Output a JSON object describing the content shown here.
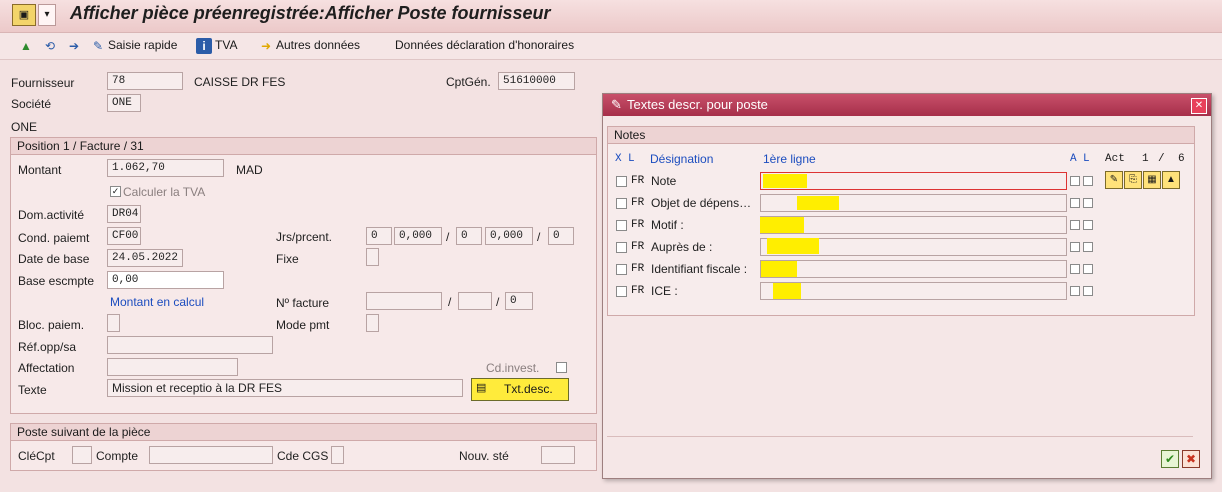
{
  "window": {
    "title": "Afficher pièce préenregistrée:Afficher Poste fournisseur"
  },
  "toolbar": {
    "saisie_rapide": "Saisie rapide",
    "tva": "TVA",
    "autres_donnees": "Autres données",
    "declaration": "Données déclaration d'honoraires"
  },
  "header": {
    "fournisseur_label": "Fournisseur",
    "fournisseur_value": "78",
    "fournisseur_name": "CAISSE DR FES",
    "cptgen_label": "CptGén.",
    "cptgen_value": "51610000",
    "societe_label": "Société",
    "societe_value": "ONE",
    "societe_text": "ONE"
  },
  "position": {
    "title": "Position 1 / Facture / 31",
    "montant_label": "Montant",
    "montant_value": "1.062,70",
    "currency": "MAD",
    "calculer_tva": "Calculer la TVA",
    "dom_activite_label": "Dom.activité",
    "dom_activite_value": "DR04",
    "cond_paiemt_label": "Cond. paiemt",
    "cond_paiemt_value": "CF00",
    "jrs_label": "Jrs/prcent.",
    "jrs_values": [
      "0",
      "0,000",
      "0",
      "0,000",
      "0"
    ],
    "slash": "/",
    "date_base_label": "Date de base",
    "date_base_value": "24.05.2022",
    "fixe_label": "Fixe",
    "base_escmpte_label": "Base escmpte",
    "base_escmpte_value": "0,00",
    "montant_calcul": "Montant en calcul",
    "no_facture_label": "Nº facture",
    "no_facture_last": "0",
    "bloc_paiem_label": "Bloc. paiem.",
    "mode_pmt_label": "Mode pmt",
    "ref_label": "Réf.opp/sa",
    "affectation_label": "Affectation",
    "cd_invest_label": "Cd.invest.",
    "texte_label": "Texte",
    "texte_value": "Mission et receptio à la DR FES",
    "txt_desc_button": "Txt.desc."
  },
  "poste_suivant": {
    "title": "Poste suivant de la pièce",
    "clecpt_label": "CléCpt",
    "compte_label": "Compte",
    "cde_cgs_label": "Cde CGS",
    "nouv_ste_label": "Nouv. sté"
  },
  "dialog": {
    "title": "Textes descr. pour poste",
    "notes_title": "Notes",
    "col_x": "X",
    "col_l": "L",
    "col_designation": "Désignation",
    "col_premiere_ligne": "1ère ligne",
    "col_a": "A",
    "col_l2": "L",
    "act_label": "Act",
    "act_value": "1",
    "act_sep": "/",
    "act_total": "6",
    "rows": [
      {
        "lang": "FR",
        "designation": "Note"
      },
      {
        "lang": "FR",
        "designation": "Objet de dépens…"
      },
      {
        "lang": "FR",
        "designation": "Motif :"
      },
      {
        "lang": "FR",
        "designation": "Auprès de :"
      },
      {
        "lang": "FR",
        "designation": "Identifiant fiscale :"
      },
      {
        "lang": "FR",
        "designation": "ICE :"
      }
    ]
  }
}
